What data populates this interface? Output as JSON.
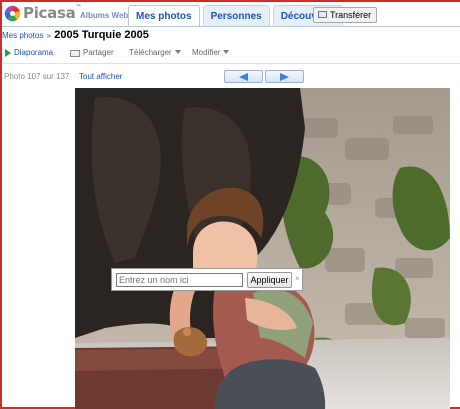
{
  "header": {
    "logo_text": "Picasa",
    "logo_subtitle": "Albums Web",
    "tabs": [
      {
        "label": "Mes photos",
        "active": true
      },
      {
        "label": "Personnes",
        "active": false
      },
      {
        "label": "Découverte",
        "active": false
      }
    ],
    "upload_label": "Transférer"
  },
  "breadcrumb": {
    "root": "Mes photos",
    "separator": "»",
    "album_title": "2005 Turquie 2005"
  },
  "toolbar": {
    "slideshow_label": "Diaporama",
    "share_label": "Partager",
    "download_label": "Télécharger",
    "edit_label": "Modifier"
  },
  "photo_nav": {
    "count_text": "Photo 107 sur 137",
    "show_all_label": "Tout afficher"
  },
  "name_tag": {
    "placeholder": "Entrez un nom ici",
    "apply_label": "Appliquer",
    "close_label": "×"
  },
  "colors": {
    "link_blue": "#1a57b6",
    "frame_red": "#c9302c",
    "nav_arrow": "#3c7fd6",
    "slideshow_green": "#2a9a3a"
  },
  "icons": [
    "picasa-logo-icon",
    "upload-icon",
    "play-icon",
    "mail-icon",
    "chevron-down-icon",
    "arrow-left-icon",
    "arrow-right-icon",
    "close-icon"
  ]
}
